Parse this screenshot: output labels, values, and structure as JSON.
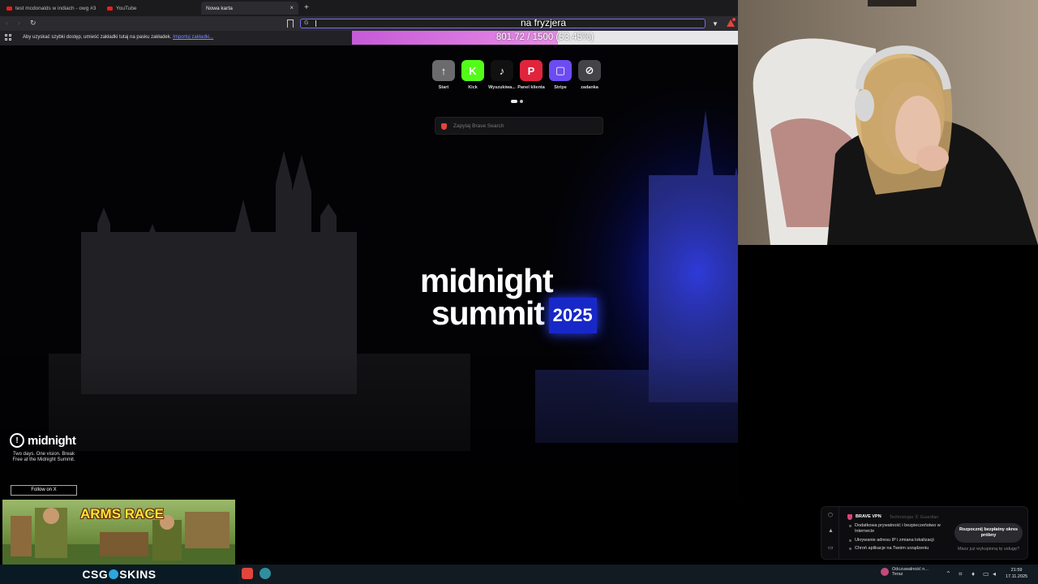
{
  "tabs": [
    {
      "label": "test mcdonalds w indiach - owg #3",
      "active": false
    },
    {
      "label": "YouTube",
      "active": false
    },
    {
      "label": "Nowa karta",
      "active": true
    }
  ],
  "new_tab_icon": "+",
  "close_icon": "×",
  "bookmarks_bar": {
    "message": "Aby uzyskać szybki dostęp, umieść zakładki tutaj na pasku zakładek.",
    "link": "Importuj zakładki..."
  },
  "overlay": {
    "title": "na fryzjera",
    "progress_text": "801.72 / 1500 (53.45%)",
    "progress_fraction": 0.5345
  },
  "top_sites": [
    {
      "label": "Start",
      "icon": "start-icon",
      "bg": "#6b6b6e",
      "glyph": "↑"
    },
    {
      "label": "Kick",
      "icon": "kick-icon",
      "bg": "#53fc18",
      "glyph": "K"
    },
    {
      "label": "Wyszukiwa...",
      "icon": "tiktok-icon",
      "bg": "#111111",
      "glyph": "♪"
    },
    {
      "label": "Panel klienta",
      "icon": "panel-icon",
      "bg": "#e0243c",
      "glyph": "P"
    },
    {
      "label": "Stripe",
      "icon": "stripe-icon",
      "bg": "#6c4cf2",
      "glyph": "▢"
    },
    {
      "label": "zadanka",
      "icon": "zadanka-icon",
      "bg": "#444448",
      "glyph": "⊘"
    }
  ],
  "search": {
    "placeholder": "Zapytaj Brave Search"
  },
  "hero": {
    "line1": "midnight",
    "line2": "summit",
    "year": "2025"
  },
  "sponsor": {
    "name": "midnight",
    "tagline": "Two days. One vision. Break Free at the Midnight Summit.",
    "follow": "Follow on X"
  },
  "ad": {
    "title": "ARMS RACE"
  },
  "taskbar": {
    "brand_left": "CSG",
    "brand_right": "SKINS",
    "notification_title": "Odczuwalność n...",
    "notification_sub": "Teraz",
    "time": "21:59",
    "date": "17.11.2025"
  },
  "vpn": {
    "brand": "BRAVE VPN",
    "tech": "Technologia ⓖ Guardian",
    "features": [
      "Dodatkowa prywatność i bezpieczeństwo w Internecie",
      "Ukrywanie adresu IP i zmiana lokalizacji",
      "Chroń aplikacje na Twoim urządzeniu"
    ],
    "cta": "Rozpocznij bezpłatny okres próbny",
    "sub": "Masz już wykupioną tę usługę?"
  },
  "colors": {
    "accent": "#7b6df0",
    "progress": "#d86fe0",
    "brave": "#e2453c",
    "hero_blue": "#1828c8"
  }
}
